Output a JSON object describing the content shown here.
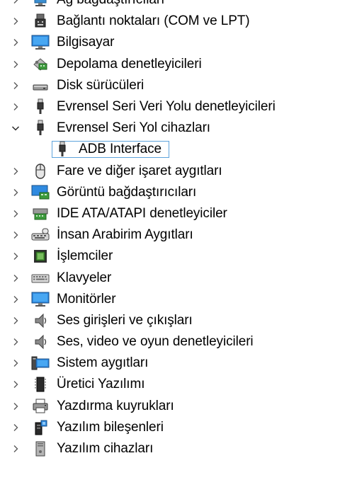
{
  "tree": {
    "items": [
      {
        "label": "Ağ bağdaştırıcıları",
        "expanded": false,
        "icon": "network-adapter-icon"
      },
      {
        "label": "Bağlantı noktaları (COM ve LPT)",
        "expanded": false,
        "icon": "port-icon"
      },
      {
        "label": "Bilgisayar",
        "expanded": false,
        "icon": "computer-icon"
      },
      {
        "label": "Depolama denetleyicileri",
        "expanded": false,
        "icon": "storage-controller-icon"
      },
      {
        "label": "Disk sürücüleri",
        "expanded": false,
        "icon": "disk-drive-icon"
      },
      {
        "label": "Evrensel Seri Veri Yolu denetleyicileri",
        "expanded": false,
        "icon": "usb-controller-icon"
      },
      {
        "label": "Evrensel Seri Yol cihazları",
        "expanded": true,
        "icon": "usb-device-icon"
      },
      {
        "label": "ADB Interface",
        "child": true,
        "selected": true,
        "icon": "usb-device-icon"
      },
      {
        "label": "Fare ve diğer işaret aygıtları",
        "expanded": false,
        "icon": "mouse-icon"
      },
      {
        "label": "Görüntü bağdaştırıcıları",
        "expanded": false,
        "icon": "display-adapter-icon"
      },
      {
        "label": "IDE ATA/ATAPI denetleyiciler",
        "expanded": false,
        "icon": "ide-controller-icon"
      },
      {
        "label": "İnsan Arabirim Aygıtları",
        "expanded": false,
        "icon": "hid-icon"
      },
      {
        "label": "İşlemciler",
        "expanded": false,
        "icon": "processor-icon"
      },
      {
        "label": "Klavyeler",
        "expanded": false,
        "icon": "keyboard-icon"
      },
      {
        "label": "Monitörler",
        "expanded": false,
        "icon": "monitor-icon"
      },
      {
        "label": "Ses girişleri ve çıkışları",
        "expanded": false,
        "icon": "speaker-icon"
      },
      {
        "label": "Ses, video ve oyun denetleyicileri",
        "expanded": false,
        "icon": "sound-controller-icon"
      },
      {
        "label": "Sistem aygıtları",
        "expanded": false,
        "icon": "system-device-icon"
      },
      {
        "label": "Üretici Yazılımı",
        "expanded": false,
        "icon": "firmware-icon"
      },
      {
        "label": "Yazdırma kuyrukları",
        "expanded": false,
        "icon": "printer-icon"
      },
      {
        "label": "Yazılım bileşenleri",
        "expanded": false,
        "icon": "software-component-icon"
      },
      {
        "label": "Yazılım cihazları",
        "expanded": false,
        "icon": "software-device-icon"
      }
    ]
  },
  "colors": {
    "text": "#000000",
    "chevron": "#5a5a5a",
    "selection_border": "#5ea3dc"
  }
}
